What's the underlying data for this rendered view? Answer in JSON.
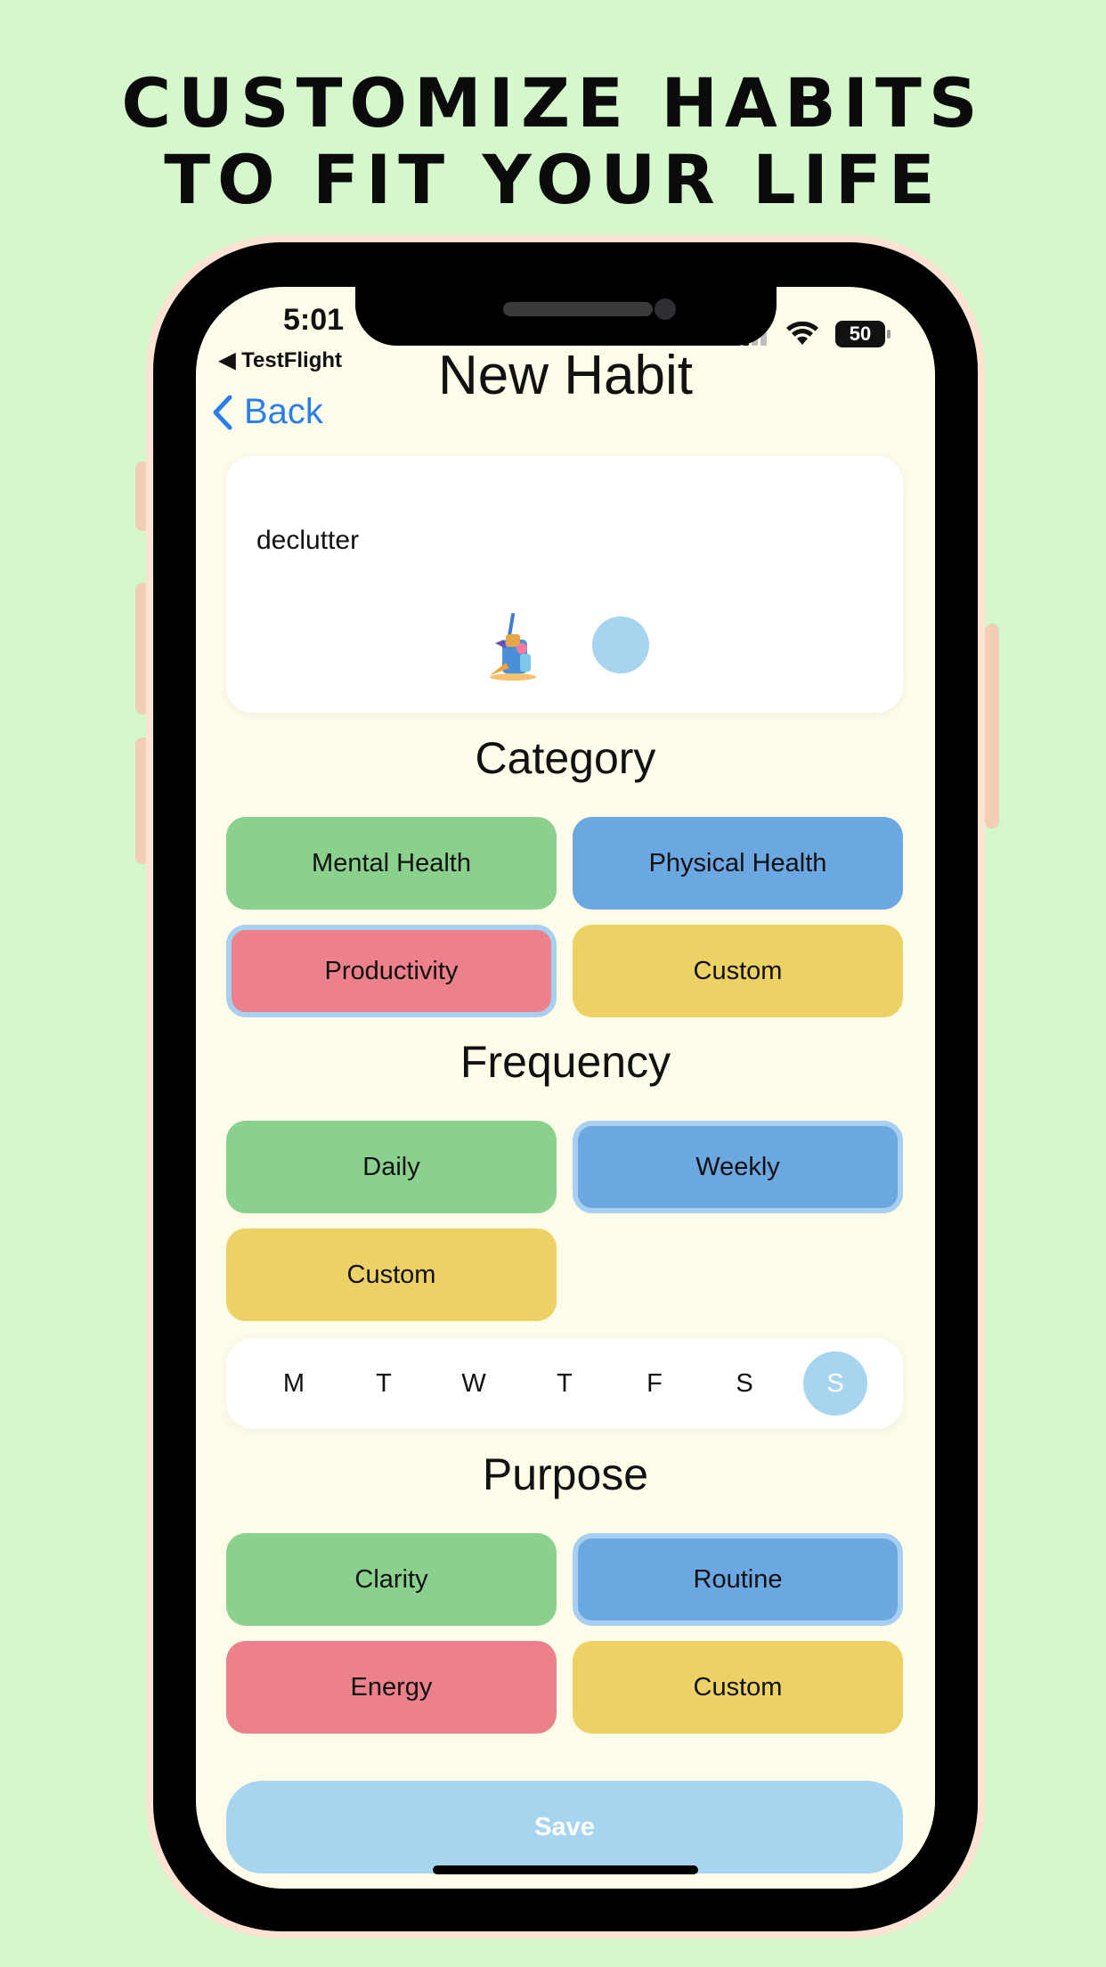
{
  "headline": {
    "line1": "CUSTOMIZE HABITS",
    "line2": "TO FIT YOUR LIFE"
  },
  "status_bar": {
    "time": "5:01",
    "back_app": "◀ TestFlight",
    "battery": "50"
  },
  "nav": {
    "title": "New Habit",
    "back_label": "Back"
  },
  "habit": {
    "name": "declutter",
    "emoji_icon": "broom-bucket-icon",
    "color": "#a7d4ef"
  },
  "category": {
    "title": "Category",
    "options": [
      {
        "label": "Mental Health",
        "color": "#8ad18e",
        "selected": false
      },
      {
        "label": "Physical Health",
        "color": "#6ba7e0",
        "selected": false
      },
      {
        "label": "Productivity",
        "color": "#ec818b",
        "selected": true
      },
      {
        "label": "Custom",
        "color": "#ecd164",
        "selected": false
      }
    ]
  },
  "frequency": {
    "title": "Frequency",
    "options": [
      {
        "label": "Daily",
        "color": "#8ad18e",
        "selected": false
      },
      {
        "label": "Weekly",
        "color": "#6ba7e0",
        "selected": true
      },
      {
        "label": "Custom",
        "color": "#ecd164",
        "selected": false
      }
    ],
    "days": [
      {
        "label": "M",
        "selected": false
      },
      {
        "label": "T",
        "selected": false
      },
      {
        "label": "W",
        "selected": false
      },
      {
        "label": "T",
        "selected": false
      },
      {
        "label": "F",
        "selected": false
      },
      {
        "label": "S",
        "selected": false
      },
      {
        "label": "S",
        "selected": true
      }
    ]
  },
  "purpose": {
    "title": "Purpose",
    "options": [
      {
        "label": "Clarity",
        "color": "#8ad18e",
        "selected": false
      },
      {
        "label": "Routine",
        "color": "#6ba7e0",
        "selected": true
      },
      {
        "label": "Energy",
        "color": "#ec818b",
        "selected": false
      },
      {
        "label": "Custom",
        "color": "#ecd164",
        "selected": false
      }
    ]
  },
  "save_label": "Save",
  "colors": {
    "background": "#d4f8cc",
    "screen": "#fefde9",
    "accent": "#2a7fea",
    "selection_ring": "#a6cff0"
  }
}
